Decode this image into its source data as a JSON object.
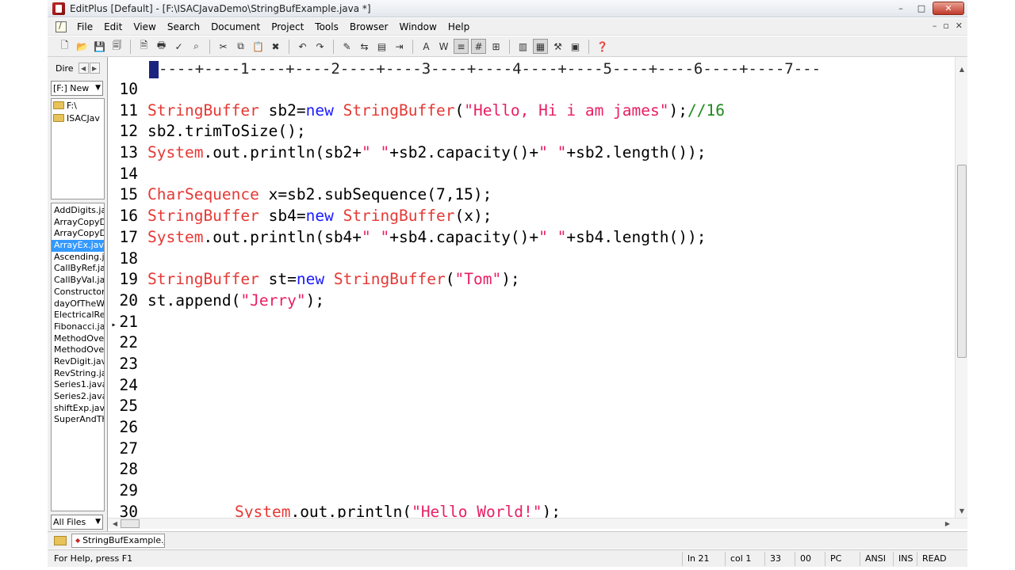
{
  "window": {
    "title": "EditPlus [Default] - [F:\\ISACJavaDemo\\StringBufExample.java *]",
    "controls": {
      "minimize": "–",
      "maximize": "□",
      "close": "✕"
    }
  },
  "menu": {
    "items": [
      "File",
      "Edit",
      "View",
      "Search",
      "Document",
      "Project",
      "Tools",
      "Browser",
      "Window",
      "Help"
    ],
    "mdi_controls": {
      "minimize": "–",
      "restore": "▫",
      "close": "✕"
    }
  },
  "toolbar": {
    "buttons": [
      {
        "icon": "new-file-icon",
        "glyph": "🗋"
      },
      {
        "icon": "open-folder-icon",
        "glyph": "📂"
      },
      {
        "icon": "save-icon",
        "glyph": "💾"
      },
      {
        "icon": "save-all-icon",
        "glyph": "🗐"
      },
      {
        "sep": true
      },
      {
        "icon": "print-preview-icon",
        "glyph": "🗎"
      },
      {
        "icon": "print-icon",
        "glyph": "🖶"
      },
      {
        "icon": "spell-check-icon",
        "glyph": "✓"
      },
      {
        "icon": "find-in-files-icon",
        "glyph": "⌕"
      },
      {
        "sep": true
      },
      {
        "icon": "cut-icon",
        "glyph": "✂"
      },
      {
        "icon": "copy-icon",
        "glyph": "⧉"
      },
      {
        "icon": "paste-icon",
        "glyph": "📋"
      },
      {
        "icon": "delete-icon",
        "glyph": "✖"
      },
      {
        "sep": true
      },
      {
        "icon": "undo-icon",
        "glyph": "↶"
      },
      {
        "icon": "redo-icon",
        "glyph": "↷"
      },
      {
        "sep": true
      },
      {
        "icon": "find-icon",
        "glyph": "✎"
      },
      {
        "icon": "replace-icon",
        "glyph": "⇆"
      },
      {
        "icon": "clipboard-icon",
        "glyph": "▤"
      },
      {
        "icon": "indent-icon",
        "glyph": "⇥"
      },
      {
        "sep": true
      },
      {
        "icon": "font-icon",
        "glyph": "A"
      },
      {
        "icon": "word-wrap-icon",
        "glyph": "W"
      },
      {
        "icon": "ruler-icon",
        "glyph": "≡",
        "pressed": true
      },
      {
        "icon": "line-number-icon",
        "glyph": "#",
        "pressed": true
      },
      {
        "icon": "toggle-view-icon",
        "glyph": "⊞"
      },
      {
        "sep": true
      },
      {
        "icon": "directory-window-icon",
        "glyph": "▥"
      },
      {
        "icon": "output-window-icon",
        "glyph": "▦",
        "pressed": true
      },
      {
        "icon": "tools-icon",
        "glyph": "⚒"
      },
      {
        "icon": "browser-icon",
        "glyph": "▣"
      },
      {
        "sep": true
      },
      {
        "icon": "help-icon",
        "glyph": "❓"
      }
    ]
  },
  "left_panel": {
    "tab_label": "Dire",
    "arrows": [
      "◀",
      "▶"
    ],
    "drive": "[F:] New",
    "tree": [
      "F:\\",
      "ISACJav"
    ],
    "files": [
      "AddDigits.ja",
      "ArrayCopyD",
      "ArrayCopyD",
      "ArrayEx.java",
      "Ascending.j",
      "CallByRef.ja",
      "CallByVal.ja",
      "Constructor",
      "dayOfTheW",
      "ElectricalRe",
      "Fibonacci.ja",
      "MethodOve",
      "MethodOve",
      "RevDigit.jav",
      "RevString.ja",
      "Series1.java",
      "Series2.java",
      "shiftExp.java",
      "SuperAndTh"
    ],
    "selected_file_index": 3,
    "filter": "All Files"
  },
  "editor": {
    "ruler": "----+----1----+----2----+----3----+----4----+----5----+----6----+----7---",
    "current_line": 21,
    "lines": [
      {
        "n": "10",
        "tokens": []
      },
      {
        "n": "11",
        "tokens": [
          {
            "t": "StringBuffer",
            "c": "kw-type"
          },
          {
            "t": " sb2=",
            "c": "plain"
          },
          {
            "t": "new",
            "c": "kw"
          },
          {
            "t": " ",
            "c": "plain"
          },
          {
            "t": "StringBuffer",
            "c": "kw-type"
          },
          {
            "t": "(",
            "c": "plain"
          },
          {
            "t": "\"Hello, Hi i am james\"",
            "c": "str"
          },
          {
            "t": ");",
            "c": "plain"
          },
          {
            "t": "//16",
            "c": "cmt"
          }
        ]
      },
      {
        "n": "12",
        "tokens": [
          {
            "t": "sb2.trimToSize();",
            "c": "plain"
          }
        ]
      },
      {
        "n": "13",
        "tokens": [
          {
            "t": "System",
            "c": "kw-type"
          },
          {
            "t": ".out.println(sb2+",
            "c": "plain"
          },
          {
            "t": "\" \"",
            "c": "str"
          },
          {
            "t": "+sb2.capacity()+",
            "c": "plain"
          },
          {
            "t": "\" \"",
            "c": "str"
          },
          {
            "t": "+sb2.length());",
            "c": "plain"
          }
        ]
      },
      {
        "n": "14",
        "tokens": []
      },
      {
        "n": "15",
        "tokens": [
          {
            "t": "CharSequence",
            "c": "kw-type"
          },
          {
            "t": " x=sb2.subSequence(7,15);",
            "c": "plain"
          }
        ]
      },
      {
        "n": "16",
        "tokens": [
          {
            "t": "StringBuffer",
            "c": "kw-type"
          },
          {
            "t": " sb4=",
            "c": "plain"
          },
          {
            "t": "new",
            "c": "kw"
          },
          {
            "t": " ",
            "c": "plain"
          },
          {
            "t": "StringBuffer",
            "c": "kw-type"
          },
          {
            "t": "(x);",
            "c": "plain"
          }
        ]
      },
      {
        "n": "17",
        "tokens": [
          {
            "t": "System",
            "c": "kw-type"
          },
          {
            "t": ".out.println(sb4+",
            "c": "plain"
          },
          {
            "t": "\" \"",
            "c": "str"
          },
          {
            "t": "+sb4.capacity()+",
            "c": "plain"
          },
          {
            "t": "\" \"",
            "c": "str"
          },
          {
            "t": "+sb4.length());",
            "c": "plain"
          }
        ]
      },
      {
        "n": "18",
        "tokens": []
      },
      {
        "n": "19",
        "tokens": [
          {
            "t": "StringBuffer",
            "c": "kw-type"
          },
          {
            "t": " st=",
            "c": "plain"
          },
          {
            "t": "new",
            "c": "kw"
          },
          {
            "t": " ",
            "c": "plain"
          },
          {
            "t": "StringBuffer",
            "c": "kw-type"
          },
          {
            "t": "(",
            "c": "plain"
          },
          {
            "t": "\"Tom\"",
            "c": "str"
          },
          {
            "t": ");",
            "c": "plain"
          }
        ]
      },
      {
        "n": "20",
        "tokens": [
          {
            "t": "st.append(",
            "c": "plain"
          },
          {
            "t": "\"Jerry\"",
            "c": "str"
          },
          {
            "t": ");",
            "c": "plain"
          }
        ]
      },
      {
        "n": "21",
        "tokens": []
      },
      {
        "n": "22",
        "tokens": []
      },
      {
        "n": "23",
        "tokens": []
      },
      {
        "n": "24",
        "tokens": []
      },
      {
        "n": "25",
        "tokens": []
      },
      {
        "n": "26",
        "tokens": []
      },
      {
        "n": "27",
        "tokens": []
      },
      {
        "n": "28",
        "tokens": []
      },
      {
        "n": "29",
        "tokens": []
      },
      {
        "n": "30",
        "indent": true,
        "tokens": [
          {
            "t": "System",
            "c": "kw-type"
          },
          {
            "t": ".out.println(",
            "c": "plain"
          },
          {
            "t": "\"Hello World!\"",
            "c": "str"
          },
          {
            "t": ");",
            "c": "plain"
          }
        ]
      }
    ]
  },
  "tabbar": {
    "active_tab": "StringBufExample.ja"
  },
  "statusbar": {
    "help": "For Help, press F1",
    "line": "ln 21",
    "col": "col 1",
    "code": "33",
    "hex": "00",
    "eol": "PC",
    "encoding": "ANSI",
    "mode": "INS",
    "access": "READ"
  },
  "colors": {
    "type": "#e53935",
    "keyword": "#1a1aff",
    "string": "#e91e63",
    "comment": "#1b8a1b",
    "selection": "#3399ff"
  }
}
